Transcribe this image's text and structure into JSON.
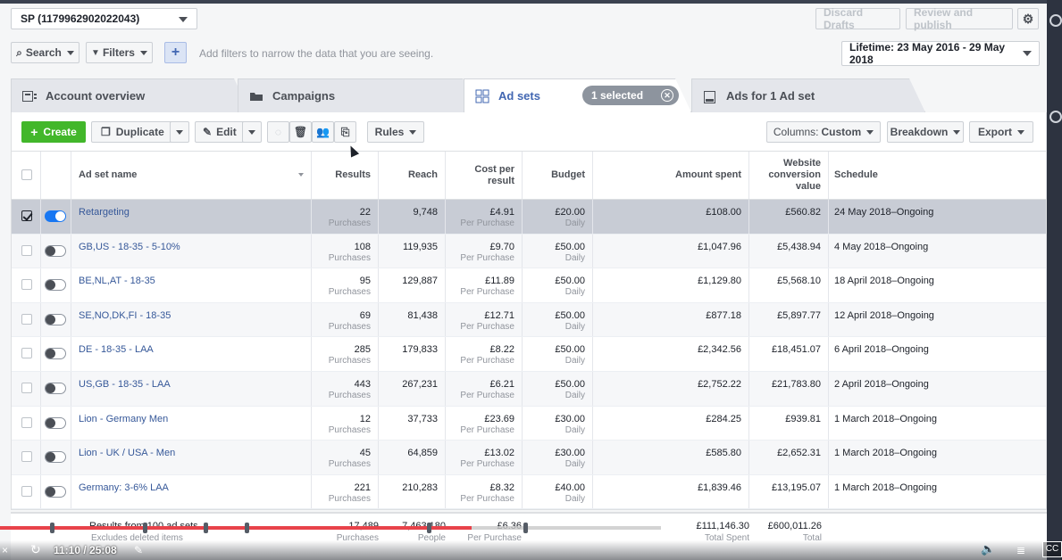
{
  "account": {
    "label": "SP (1179962902022043)"
  },
  "header": {
    "discard_label": "Discard Drafts",
    "review_label": "Review and publish",
    "settings_icon": "gear-icon"
  },
  "filterbar": {
    "search_label": "Search",
    "filters_label": "Filters",
    "plus_label": "+",
    "hint": "Add filters to narrow the data that you are seeing.",
    "date_range": "Lifetime: 23 May 2016 - 29 May 2018"
  },
  "tabs": [
    {
      "label": "Account overview",
      "icon": "account-overview-icon"
    },
    {
      "label": "Campaigns",
      "icon": "folder-icon"
    },
    {
      "label": "Ad sets",
      "icon": "grid-icon"
    },
    {
      "label": "Ads for 1 Ad set",
      "icon": "ad-icon"
    }
  ],
  "selection": {
    "label": "1 selected",
    "close": "✕"
  },
  "toolbar": {
    "create_label": "Create",
    "duplicate_label": "Duplicate",
    "edit_label": "Edit",
    "rules_label": "Rules",
    "columns_prefix": "Columns:",
    "columns_value": "Custom",
    "breakdown_label": "Breakdown",
    "export_label": "Export"
  },
  "table": {
    "headers": {
      "name": "Ad set name",
      "results": "Results",
      "reach": "Reach",
      "cpr": "Cost per result",
      "budget": "Budget",
      "amount": "Amount spent",
      "wcv": "Website conversion value",
      "schedule": "Schedule"
    },
    "rows": [
      {
        "name": "Retargeting",
        "on": true,
        "checked": true,
        "results": "22",
        "results_sub": "Purchases",
        "reach": "9,748",
        "cpr": "£4.91",
        "cpr_sub": "Per Purchase",
        "budget": "£20.00",
        "budget_sub": "Daily",
        "amount": "£108.00",
        "wcv": "£560.82",
        "schedule": "24 May 2018–Ongoing"
      },
      {
        "name": "GB,US - 18-35 - 5-10%",
        "on": false,
        "checked": false,
        "results": "108",
        "results_sub": "Purchases",
        "reach": "119,935",
        "cpr": "£9.70",
        "cpr_sub": "Per Purchase",
        "budget": "£50.00",
        "budget_sub": "Daily",
        "amount": "£1,047.96",
        "wcv": "£5,438.94",
        "schedule": "4 May 2018–Ongoing"
      },
      {
        "name": "BE,NL,AT - 18-35",
        "on": false,
        "checked": false,
        "results": "95",
        "results_sub": "Purchases",
        "reach": "129,887",
        "cpr": "£11.89",
        "cpr_sub": "Per Purchase",
        "budget": "£50.00",
        "budget_sub": "Daily",
        "amount": "£1,129.80",
        "wcv": "£5,568.10",
        "schedule": "18 April 2018–Ongoing"
      },
      {
        "name": "SE,NO,DK,FI - 18-35",
        "on": false,
        "checked": false,
        "results": "69",
        "results_sub": "Purchases",
        "reach": "81,438",
        "cpr": "£12.71",
        "cpr_sub": "Per Purchase",
        "budget": "£50.00",
        "budget_sub": "Daily",
        "amount": "£877.18",
        "wcv": "£5,897.77",
        "schedule": "12 April 2018–Ongoing"
      },
      {
        "name": "DE - 18-35 - LAA",
        "on": false,
        "checked": false,
        "results": "285",
        "results_sub": "Purchases",
        "reach": "179,833",
        "cpr": "£8.22",
        "cpr_sub": "Per Purchase",
        "budget": "£50.00",
        "budget_sub": "Daily",
        "amount": "£2,342.56",
        "wcv": "£18,451.07",
        "schedule": "6 April 2018–Ongoing"
      },
      {
        "name": "US,GB - 18-35 - LAA",
        "on": false,
        "checked": false,
        "results": "443",
        "results_sub": "Purchases",
        "reach": "267,231",
        "cpr": "£6.21",
        "cpr_sub": "Per Purchase",
        "budget": "£50.00",
        "budget_sub": "Daily",
        "amount": "£2,752.22",
        "wcv": "£21,783.80",
        "schedule": "2 April 2018–Ongoing"
      },
      {
        "name": "Lion - Germany Men",
        "on": false,
        "checked": false,
        "results": "12",
        "results_sub": "Purchases",
        "reach": "37,733",
        "cpr": "£23.69",
        "cpr_sub": "Per Purchase",
        "budget": "£30.00",
        "budget_sub": "Daily",
        "amount": "£284.25",
        "wcv": "£939.81",
        "schedule": "1 March 2018–Ongoing"
      },
      {
        "name": "Lion - UK / USA - Men",
        "on": false,
        "checked": false,
        "results": "45",
        "results_sub": "Purchases",
        "reach": "64,859",
        "cpr": "£13.02",
        "cpr_sub": "Per Purchase",
        "budget": "£30.00",
        "budget_sub": "Daily",
        "amount": "£585.80",
        "wcv": "£2,652.31",
        "schedule": "1 March 2018–Ongoing"
      },
      {
        "name": "Germany: 3-6% LAA",
        "on": false,
        "checked": false,
        "results": "221",
        "results_sub": "Purchases",
        "reach": "210,283",
        "cpr": "£8.32",
        "cpr_sub": "Per Purchase",
        "budget": "£40.00",
        "budget_sub": "Daily",
        "amount": "£1,839.46",
        "wcv": "£13,195.07",
        "schedule": "1 March 2018–Ongoing"
      }
    ],
    "totals": {
      "label": "Results from 100 ad sets",
      "sub": "Excludes deleted items",
      "results": "17,489",
      "results_sub": "Purchases",
      "reach": "7,463,180",
      "reach_sub": "People",
      "cpr": "£6.36",
      "cpr_sub": "Per Purchase",
      "amount": "£111,146.30",
      "amount_sub": "Total Spent",
      "wcv": "£600,011.26",
      "wcv_sub": "Total"
    }
  },
  "video": {
    "time": "11:10 / 25:08",
    "progress": 0.713,
    "cc": "CC"
  },
  "colors": {
    "accent": "#4267b2",
    "create": "#42b72a",
    "progress": "#e8424a",
    "toggle_on": "#1877f2"
  }
}
